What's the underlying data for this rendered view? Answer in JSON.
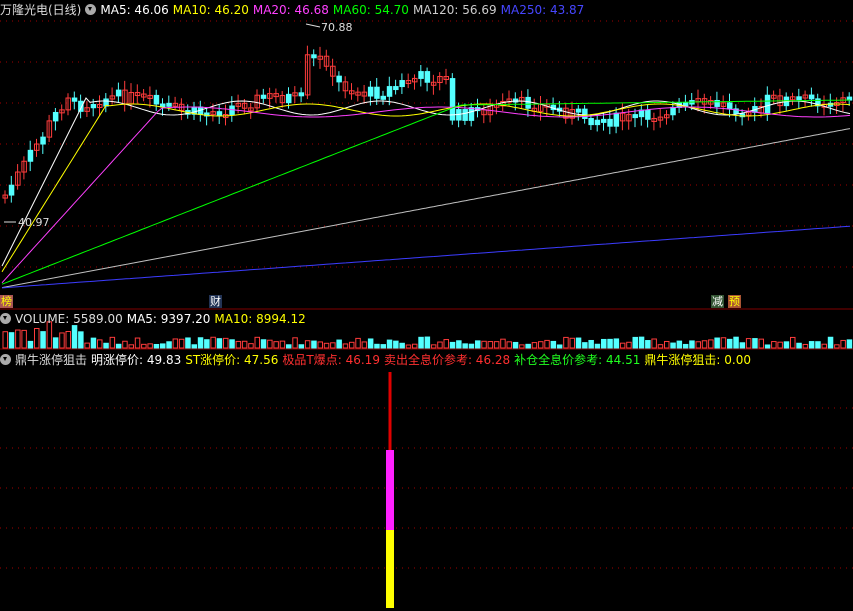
{
  "main_header": {
    "title": "万隆光电(日线)",
    "ma5": "MA5: 46.06",
    "ma10": "MA10: 46.20",
    "ma20": "MA20: 46.68",
    "ma60": "MA60: 54.70",
    "ma120": "MA120: 56.69",
    "ma250": "MA250: 43.87"
  },
  "annotations": {
    "high": "70.88",
    "low": "40.97"
  },
  "event_markers": {
    "left": "榜",
    "mid": "财",
    "r1": "减",
    "r2": "预"
  },
  "volume_header": {
    "volume": "VOLUME: 5589.00",
    "ma5": "MA5: 9397.20",
    "ma10": "MA10: 8994.12"
  },
  "indicator_header": {
    "name": "鼎牛涨停狙击",
    "ming": "明涨停价: 49.83",
    "st": "ST涨停价: 47.56",
    "jp": "极品T爆点: 46.19",
    "sell": "卖出全息价参考: 46.28",
    "buy": "补仓全息价参考: 44.51",
    "snipe": "鼎牛涨停狙击: 0.00"
  },
  "colors": {
    "up": "#ff3c3c",
    "down": "#54ffff",
    "ma5": "#ffffff",
    "ma10": "#ffff00",
    "ma20": "#ff40ff",
    "ma60": "#00ff00",
    "ma120": "#c0c0c0",
    "ma250": "#3c3cff",
    "grid": "#a00000"
  }
}
